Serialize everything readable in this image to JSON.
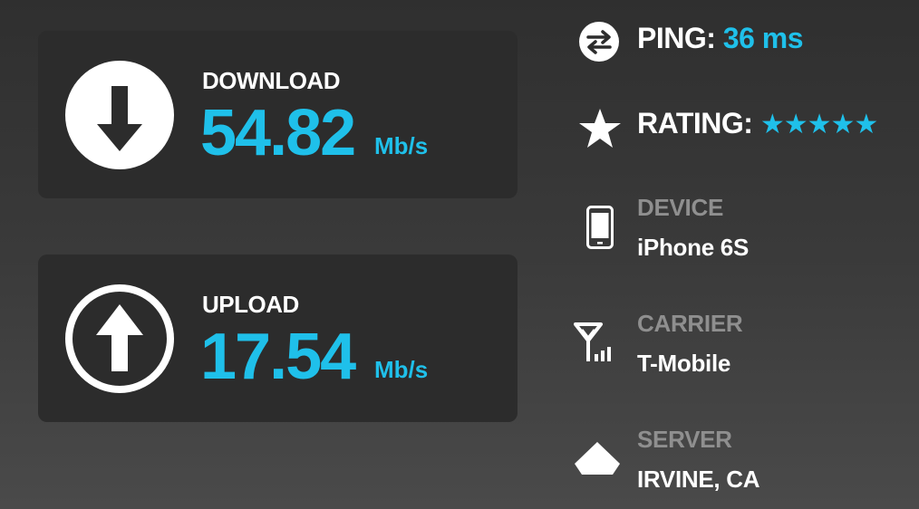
{
  "download": {
    "label": "DOWNLOAD",
    "value": "54.82",
    "unit": "Mb/s",
    "icon": "arrow-down-circle-icon"
  },
  "upload": {
    "label": "UPLOAD",
    "value": "17.54",
    "unit": "Mb/s",
    "icon": "arrow-up-circle-icon"
  },
  "ping": {
    "label": "PING:",
    "value": "36 ms",
    "icon": "swap-arrows-icon"
  },
  "rating": {
    "label": "RATING:",
    "stars_text": "★★★★★",
    "stars": 5,
    "icon": "star-icon"
  },
  "device": {
    "title": "DEVICE",
    "value": "iPhone 6S",
    "icon": "phone-icon"
  },
  "carrier": {
    "title": "CARRIER",
    "value": "T-Mobile",
    "icon": "signal-icon"
  },
  "server": {
    "title": "SERVER",
    "value": "IRVINE, CA",
    "icon": "server-icon"
  },
  "colors": {
    "accent": "#1fc0ea",
    "card": "#2c2c2c",
    "muted": "#8f8f8f",
    "text": "#ffffff"
  }
}
